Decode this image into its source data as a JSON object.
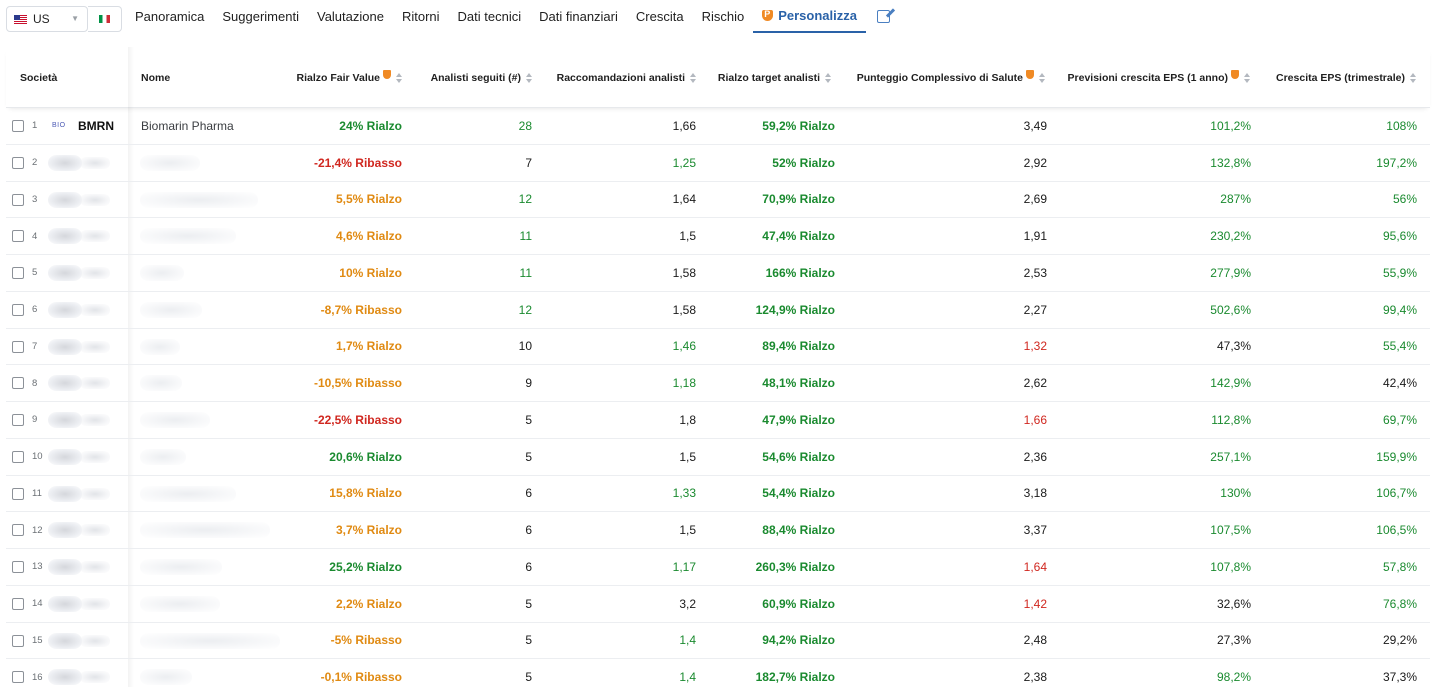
{
  "topbar": {
    "country_label": "US",
    "tabs": [
      {
        "label": "Panoramica"
      },
      {
        "label": "Suggerimenti"
      },
      {
        "label": "Valutazione"
      },
      {
        "label": "Ritorni"
      },
      {
        "label": "Dati tecnici"
      },
      {
        "label": "Dati finanziari"
      },
      {
        "label": "Crescita"
      },
      {
        "label": "Rischio"
      },
      {
        "label": "Personalizza"
      }
    ]
  },
  "colors": {
    "positive": "#1a8a2f",
    "negative": "#d0271f",
    "neutral": "#e08a12",
    "accent": "#2a62a8",
    "pro_badge": "#f08a24"
  },
  "table": {
    "headers": {
      "company": "Società",
      "name": "Nome",
      "fair_value": "Rialzo Fair Value",
      "analysts": "Analisti seguiti (#)",
      "recommendations": "Raccomandazioni analisti",
      "target": "Rialzo target analisti",
      "health": "Punteggio Complessivo di Salute",
      "eps_forecast": "Previsioni crescita EPS (1 anno)",
      "eps_growth": "Crescita EPS (trimestrale)"
    },
    "rows": [
      {
        "num": "1",
        "logo": "BIO",
        "ticker": "BMRN",
        "name": "Biomarin Pharma",
        "fv": "24% Rialzo",
        "fv_tone": "green",
        "an": "28",
        "an_tone": "green",
        "rec": "1,66",
        "rec_tone": "black",
        "tgt": "59,2% Rialzo",
        "hs": "3,49",
        "hs_tone": "black",
        "epsf": "101,2%",
        "epsf_tone": "green",
        "epsq": "108%",
        "epsq_tone": "green"
      },
      {
        "num": "2",
        "fv": "-21,4% Ribasso",
        "fv_tone": "red",
        "an": "7",
        "an_tone": "black",
        "rec": "1,25",
        "rec_tone": "green",
        "tgt": "52% Rialzo",
        "hs": "2,92",
        "hs_tone": "black",
        "epsf": "132,8%",
        "epsf_tone": "green",
        "epsq": "197,2%",
        "epsq_tone": "green"
      },
      {
        "num": "3",
        "fv": "5,5% Rialzo",
        "fv_tone": "orange",
        "an": "12",
        "an_tone": "green",
        "rec": "1,64",
        "rec_tone": "black",
        "tgt": "70,9% Rialzo",
        "hs": "2,69",
        "hs_tone": "black",
        "epsf": "287%",
        "epsf_tone": "green",
        "epsq": "56%",
        "epsq_tone": "green"
      },
      {
        "num": "4",
        "fv": "4,6% Rialzo",
        "fv_tone": "orange",
        "an": "11",
        "an_tone": "green",
        "rec": "1,5",
        "rec_tone": "black",
        "tgt": "47,4% Rialzo",
        "hs": "1,91",
        "hs_tone": "black",
        "epsf": "230,2%",
        "epsf_tone": "green",
        "epsq": "95,6%",
        "epsq_tone": "green"
      },
      {
        "num": "5",
        "fv": "10% Rialzo",
        "fv_tone": "orange",
        "an": "11",
        "an_tone": "green",
        "rec": "1,58",
        "rec_tone": "black",
        "tgt": "166% Rialzo",
        "hs": "2,53",
        "hs_tone": "black",
        "epsf": "277,9%",
        "epsf_tone": "green",
        "epsq": "55,9%",
        "epsq_tone": "green"
      },
      {
        "num": "6",
        "fv": "-8,7% Ribasso",
        "fv_tone": "orange",
        "an": "12",
        "an_tone": "green",
        "rec": "1,58",
        "rec_tone": "black",
        "tgt": "124,9% Rialzo",
        "hs": "2,27",
        "hs_tone": "black",
        "epsf": "502,6%",
        "epsf_tone": "green",
        "epsq": "99,4%",
        "epsq_tone": "green"
      },
      {
        "num": "7",
        "fv": "1,7% Rialzo",
        "fv_tone": "orange",
        "an": "10",
        "an_tone": "black",
        "rec": "1,46",
        "rec_tone": "green",
        "tgt": "89,4% Rialzo",
        "hs": "1,32",
        "hs_tone": "red",
        "epsf": "47,3%",
        "epsf_tone": "black",
        "epsq": "55,4%",
        "epsq_tone": "green"
      },
      {
        "num": "8",
        "fv": "-10,5% Ribasso",
        "fv_tone": "orange",
        "an": "9",
        "an_tone": "black",
        "rec": "1,18",
        "rec_tone": "green",
        "tgt": "48,1% Rialzo",
        "hs": "2,62",
        "hs_tone": "black",
        "epsf": "142,9%",
        "epsf_tone": "green",
        "epsq": "42,4%",
        "epsq_tone": "black"
      },
      {
        "num": "9",
        "fv": "-22,5% Ribasso",
        "fv_tone": "red",
        "an": "5",
        "an_tone": "black",
        "rec": "1,8",
        "rec_tone": "black",
        "tgt": "47,9% Rialzo",
        "hs": "1,66",
        "hs_tone": "red",
        "epsf": "112,8%",
        "epsf_tone": "green",
        "epsq": "69,7%",
        "epsq_tone": "green"
      },
      {
        "num": "10",
        "fv": "20,6% Rialzo",
        "fv_tone": "green",
        "an": "5",
        "an_tone": "black",
        "rec": "1,5",
        "rec_tone": "black",
        "tgt": "54,6% Rialzo",
        "hs": "2,36",
        "hs_tone": "black",
        "epsf": "257,1%",
        "epsf_tone": "green",
        "epsq": "159,9%",
        "epsq_tone": "green"
      },
      {
        "num": "11",
        "fv": "15,8% Rialzo",
        "fv_tone": "orange",
        "an": "6",
        "an_tone": "black",
        "rec": "1,33",
        "rec_tone": "green",
        "tgt": "54,4% Rialzo",
        "hs": "3,18",
        "hs_tone": "black",
        "epsf": "130%",
        "epsf_tone": "green",
        "epsq": "106,7%",
        "epsq_tone": "green"
      },
      {
        "num": "12",
        "fv": "3,7% Rialzo",
        "fv_tone": "orange",
        "an": "6",
        "an_tone": "black",
        "rec": "1,5",
        "rec_tone": "black",
        "tgt": "88,4% Rialzo",
        "hs": "3,37",
        "hs_tone": "black",
        "epsf": "107,5%",
        "epsf_tone": "green",
        "epsq": "106,5%",
        "epsq_tone": "green"
      },
      {
        "num": "13",
        "fv": "25,2% Rialzo",
        "fv_tone": "green",
        "an": "6",
        "an_tone": "black",
        "rec": "1,17",
        "rec_tone": "green",
        "tgt": "260,3% Rialzo",
        "hs": "1,64",
        "hs_tone": "red",
        "epsf": "107,8%",
        "epsf_tone": "green",
        "epsq": "57,8%",
        "epsq_tone": "green"
      },
      {
        "num": "14",
        "fv": "2,2% Rialzo",
        "fv_tone": "orange",
        "an": "5",
        "an_tone": "black",
        "rec": "3,2",
        "rec_tone": "black",
        "tgt": "60,9% Rialzo",
        "hs": "1,42",
        "hs_tone": "red",
        "epsf": "32,6%",
        "epsf_tone": "black",
        "epsq": "76,8%",
        "epsq_tone": "green"
      },
      {
        "num": "15",
        "fv": "-5% Ribasso",
        "fv_tone": "orange",
        "an": "5",
        "an_tone": "black",
        "rec": "1,4",
        "rec_tone": "green",
        "tgt": "94,2% Rialzo",
        "hs": "2,48",
        "hs_tone": "black",
        "epsf": "27,3%",
        "epsf_tone": "black",
        "epsq": "29,2%",
        "epsq_tone": "black"
      },
      {
        "num": "16",
        "fv": "-0,1% Ribasso",
        "fv_tone": "orange",
        "an": "5",
        "an_tone": "black",
        "rec": "1,4",
        "rec_tone": "green",
        "tgt": "182,7% Rialzo",
        "hs": "2,38",
        "hs_tone": "black",
        "epsf": "98,2%",
        "epsf_tone": "green",
        "epsq": "37,3%",
        "epsq_tone": "black"
      }
    ]
  }
}
